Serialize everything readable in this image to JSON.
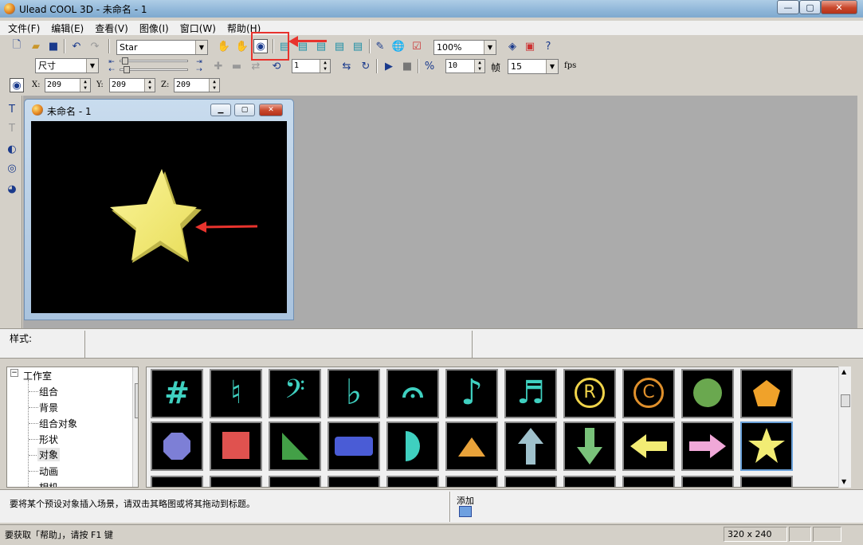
{
  "window": {
    "title": "Ulead COOL 3D - 未命名 - 1",
    "min": "—",
    "max": "▢",
    "close": "✕"
  },
  "menu": [
    "文件(F)",
    "编辑(E)",
    "查看(V)",
    "图像(I)",
    "窗口(W)",
    "帮助(H)"
  ],
  "toolbar1": {
    "object_select": "Star",
    "zoom_select": "100%"
  },
  "toolbar2": {
    "size_select": "尺寸",
    "frame_value": "1",
    "speed_value": "10",
    "frame_label": "帧",
    "fps_select": "15",
    "fps_label": "fps"
  },
  "toolbar3": {
    "x_label": "X:",
    "x_value": "209",
    "y_label": "Y:",
    "y_value": "209",
    "z_label": "Z:",
    "z_value": "209"
  },
  "document": {
    "title": "未命名 - 1"
  },
  "style_bar": {
    "label": "样式:"
  },
  "tree": {
    "root": "工作室",
    "items": [
      "组合",
      "背景",
      "组合对象",
      "形状",
      "对象",
      "动画",
      "相机"
    ],
    "expander": "−"
  },
  "gallery": {
    "row1": [
      "sharp-icon",
      "natural-icon",
      "bass-clef-icon",
      "flat-icon",
      "fermata-icon",
      "eighth-note-icon",
      "sixteenth-note-icon",
      "registered-icon",
      "copyright-icon",
      "circle-icon",
      "pentagon-icon"
    ],
    "row2": [
      "octagon-icon",
      "square-icon",
      "triangle-icon",
      "rounded-rect-icon",
      "half-circle-icon",
      "cone-icon",
      "up-arrow-icon",
      "down-arrow-icon",
      "left-arrow-icon",
      "right-arrow-icon",
      "star-icon"
    ],
    "glyphs": {
      "sharp": "#",
      "natural": "♮",
      "bass": "𝄢",
      "flat": "♭",
      "fermata": "𝄐",
      "eighth": "♪",
      "sixteenth": "♬",
      "registered": "R",
      "copyright": "C"
    }
  },
  "hint_bar": {
    "hint": "要将某个预设对象插入场景，请双击其略图或将其拖动到标题。",
    "add_label": "添加"
  },
  "status_bar": {
    "message": "要获取「帮助」，请按 F1 键",
    "size": "320 x 240"
  },
  "colors": {
    "accent_red": "#e8332d",
    "star_yellow": "#f2ec74",
    "cyan": "#3fd0c0"
  }
}
